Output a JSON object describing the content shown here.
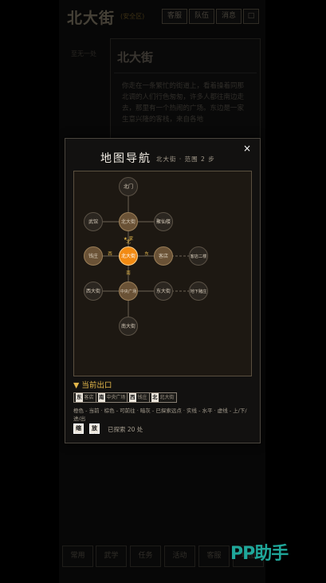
{
  "page": {
    "title": "北大街",
    "title_tag": "(安全区)",
    "top_buttons": [
      "客服",
      "队伍",
      "消息",
      "□"
    ],
    "side_label": "至无一处",
    "card_title": "北大街",
    "card_text": "你走在一条繁忙的街道上，看着操着同那北调的人们行色匆匆，许多人都往南边走去，那里有一个热闹的广场。东边是一家生意兴隆的客栈，来自各地",
    "bottom_nav": [
      "常用",
      "武学",
      "任务",
      "活动",
      "客服",
      "地图"
    ]
  },
  "watermark": "PP助手",
  "modal": {
    "title": "地图导航",
    "subtitle": "北大街 · 范围 2 步",
    "close_label": "×",
    "exits_heading": "▼ 当前出口",
    "exits": [
      {
        "dir": "东",
        "name": "客店"
      },
      {
        "dir": "南",
        "name": "中央广场"
      },
      {
        "dir": "西",
        "name": "钱庄"
      },
      {
        "dir": "北",
        "name": "北大街"
      }
    ],
    "legend": "橙色 - 当前 · 棕色 - 可前往 · 暗灰 - 已探索远点 · 实线 - 水平 · 虚线 - 上/下/进/出",
    "zoom_out": "缩小",
    "zoom_in": "放大",
    "explored": "已探索 20 处"
  },
  "map": {
    "colors": {
      "current": "#f28a12",
      "reachable": "#6a5236",
      "explored": "#2b2620",
      "line": "#5e5548",
      "dir_label": "#e2b64a"
    },
    "nodes": [
      {
        "id": "beimen",
        "label": "北门",
        "state": "explored"
      },
      {
        "id": "wuguan",
        "label": "武馆",
        "state": "explored"
      },
      {
        "id": "beidajie_n",
        "label": "北大街",
        "state": "reachable"
      },
      {
        "id": "jiuzhanglou",
        "label": "聚仙楼",
        "state": "explored"
      },
      {
        "id": "qianzhuang",
        "label": "钱庄",
        "state": "reachable"
      },
      {
        "id": "beidajie",
        "label": "北大街",
        "state": "current"
      },
      {
        "id": "kedian",
        "label": "客店",
        "state": "reachable"
      },
      {
        "id": "kedian_2f",
        "label": "客店二楼",
        "state": "explored"
      },
      {
        "id": "xidajie",
        "label": "西大街",
        "state": "explored"
      },
      {
        "id": "zhongyang",
        "label": "中央广场",
        "state": "reachable"
      },
      {
        "id": "dongdajie",
        "label": "东大街",
        "state": "explored"
      },
      {
        "id": "dixia",
        "label": "地下赌庄",
        "state": "explored"
      },
      {
        "id": "nandajie",
        "label": "南大街",
        "state": "explored"
      }
    ],
    "edges": [
      {
        "from": "beimen",
        "to": "beidajie_n"
      },
      {
        "from": "wuguan",
        "to": "beidajie_n"
      },
      {
        "from": "beidajie_n",
        "to": "jiuzhanglou"
      },
      {
        "from": "beidajie_n",
        "to": "beidajie"
      },
      {
        "from": "qianzhuang",
        "to": "beidajie"
      },
      {
        "from": "beidajie",
        "to": "kedian"
      },
      {
        "from": "kedian",
        "to": "kedian_2f",
        "dashed": true
      },
      {
        "from": "beidajie",
        "to": "zhongyang"
      },
      {
        "from": "xidajie",
        "to": "zhongyang"
      },
      {
        "from": "zhongyang",
        "to": "dongdajie"
      },
      {
        "from": "dongdajie",
        "to": "dixia",
        "dashed": true
      },
      {
        "from": "zhongyang",
        "to": "nandajie"
      }
    ],
    "dir_labels": [
      {
        "text": "北",
        "at": "n"
      },
      {
        "text": "西",
        "at": "w"
      },
      {
        "text": "东",
        "at": "e"
      },
      {
        "text": "南",
        "at": "s"
      }
    ],
    "marker": "★ 家"
  }
}
